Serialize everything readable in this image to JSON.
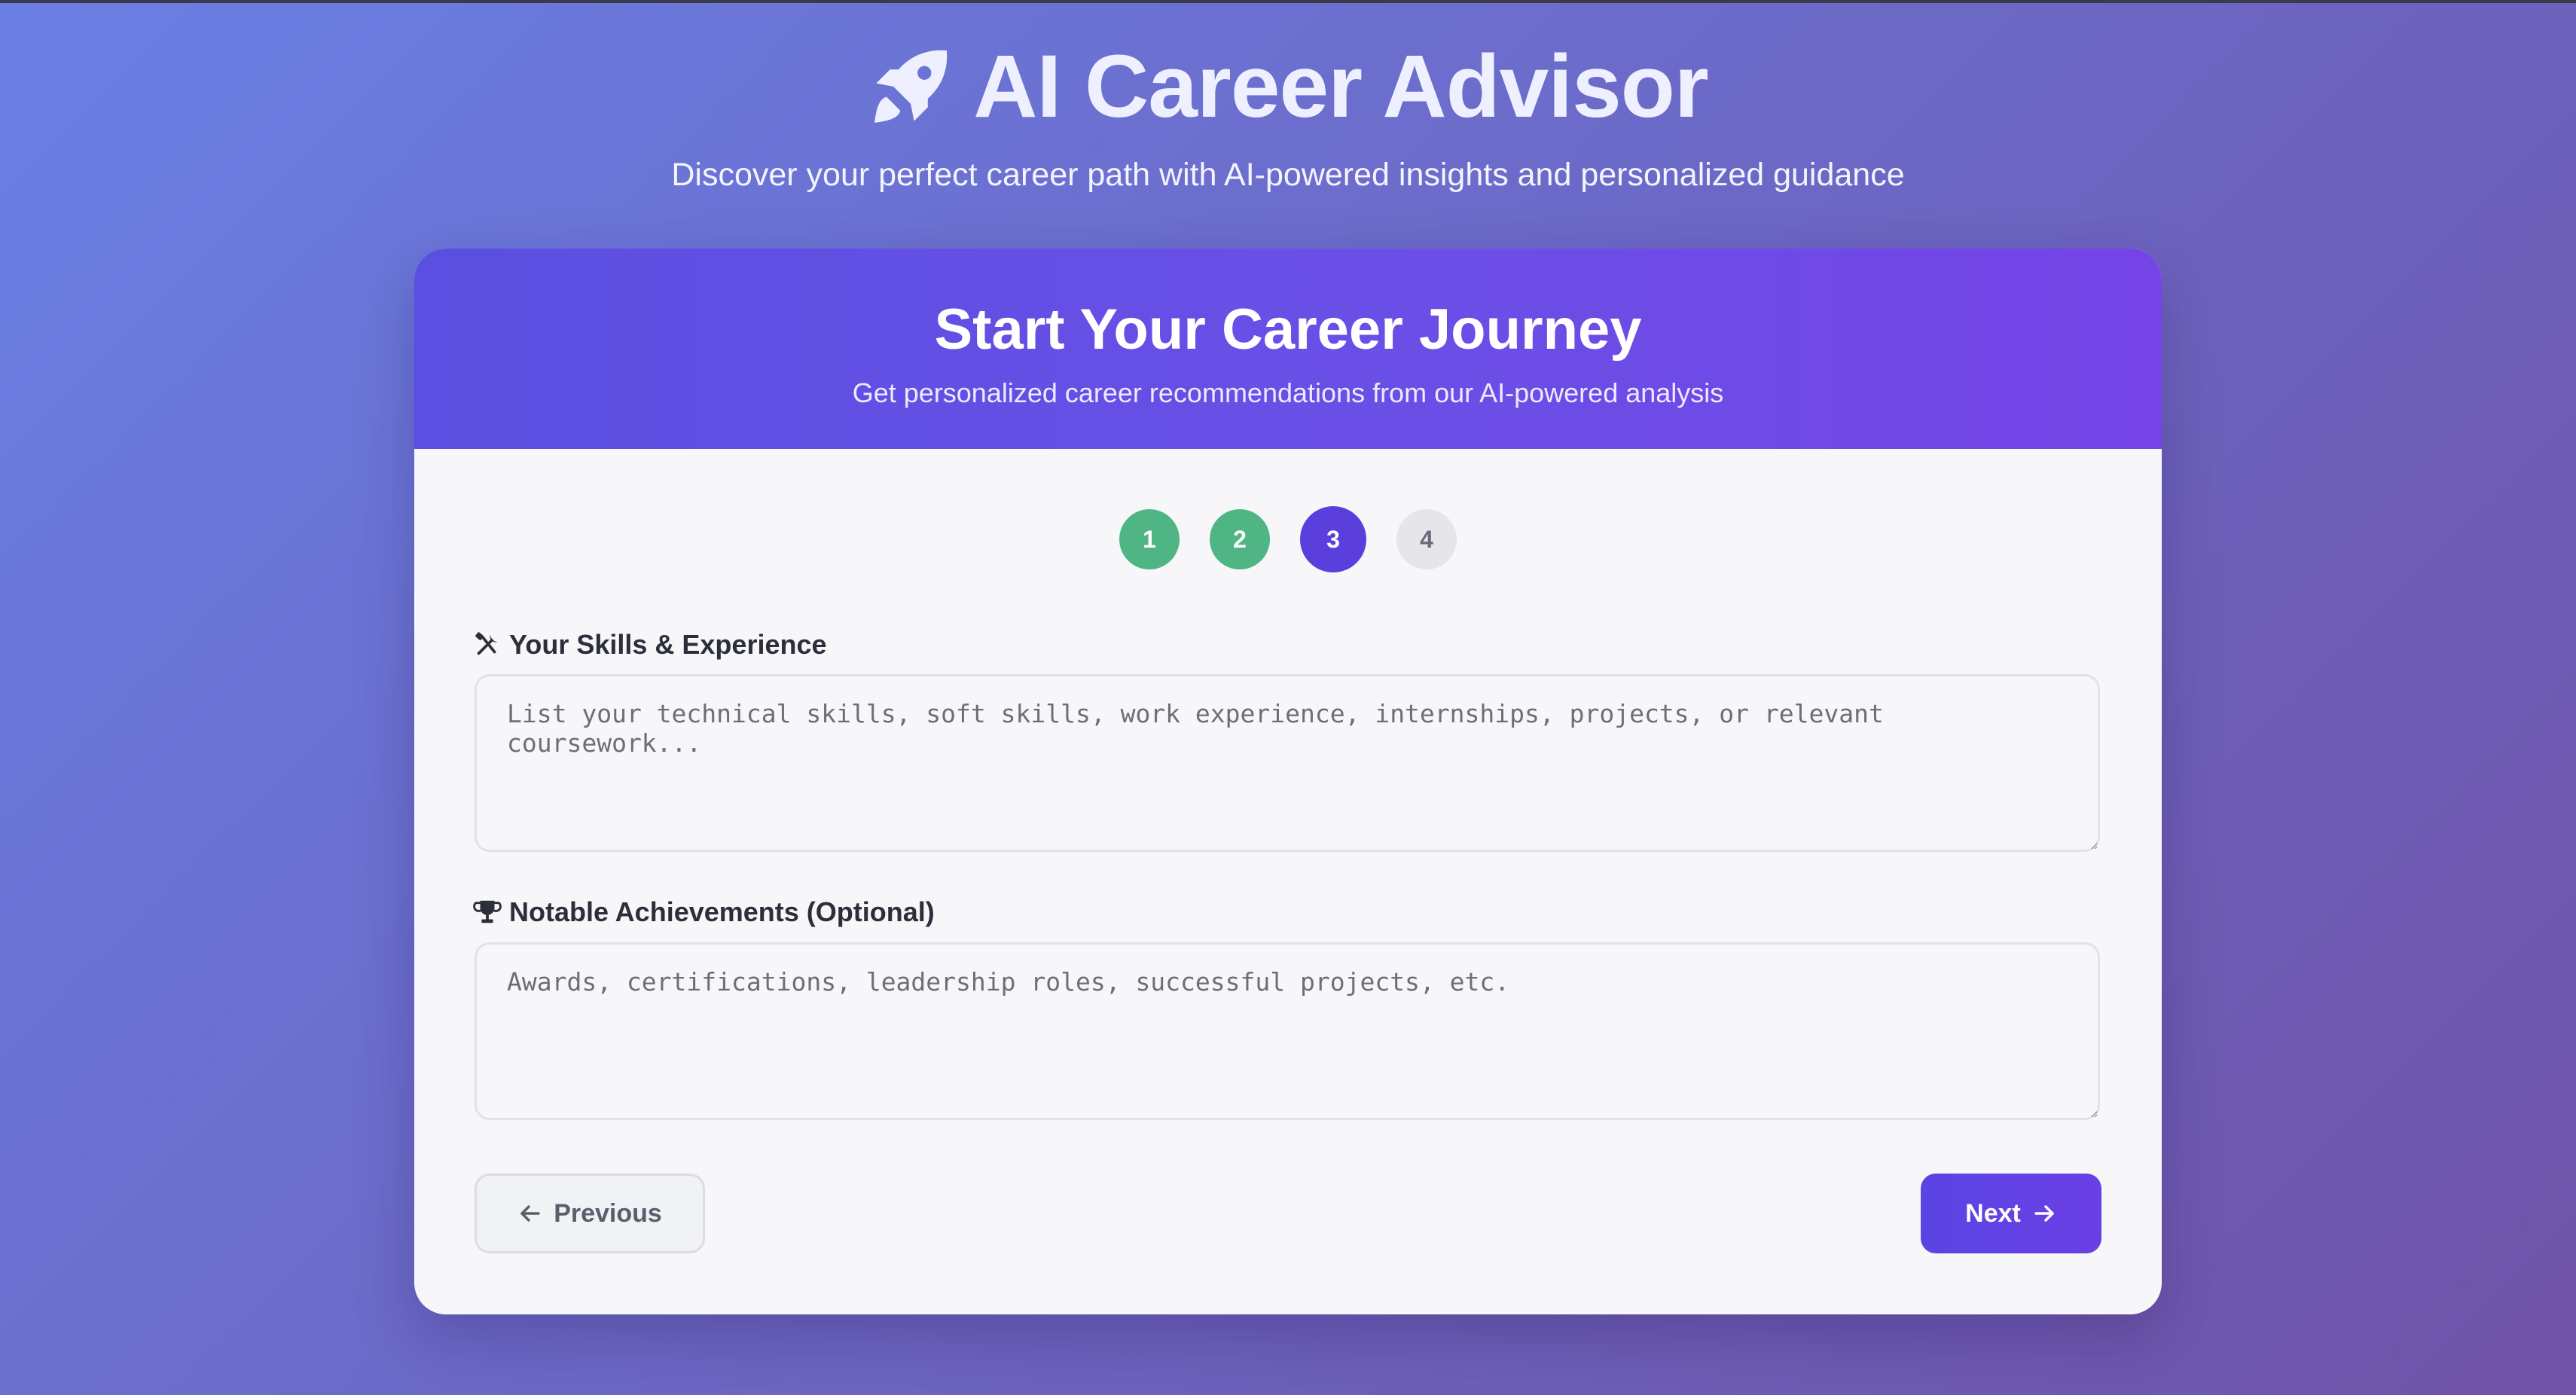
{
  "hero": {
    "icon": "rocket-icon",
    "title": "AI Career Advisor",
    "subtitle": "Discover your perfect career path with AI-powered insights and personalized guidance"
  },
  "card": {
    "title": "Start Your Career Journey",
    "subtitle": "Get personalized career recommendations from our AI-powered analysis"
  },
  "steps": [
    {
      "label": "1",
      "state": "completed"
    },
    {
      "label": "2",
      "state": "completed"
    },
    {
      "label": "3",
      "state": "active"
    },
    {
      "label": "4",
      "state": "pending"
    }
  ],
  "form": {
    "skills": {
      "icon": "tools-icon",
      "label": "Your Skills & Experience",
      "value": "",
      "placeholder": "List your technical skills, soft skills, work experience, internships, projects, or relevant coursework..."
    },
    "achievements": {
      "icon": "trophy-icon",
      "label": "Notable Achievements (Optional)",
      "value": "",
      "placeholder": "Awards, certifications, leadership roles, successful projects, etc."
    }
  },
  "buttons": {
    "previous": "Previous",
    "next": "Next"
  },
  "colors": {
    "accent": "#5a3fdc",
    "completed": "#4fb584",
    "pending": "#e6e6ea"
  }
}
